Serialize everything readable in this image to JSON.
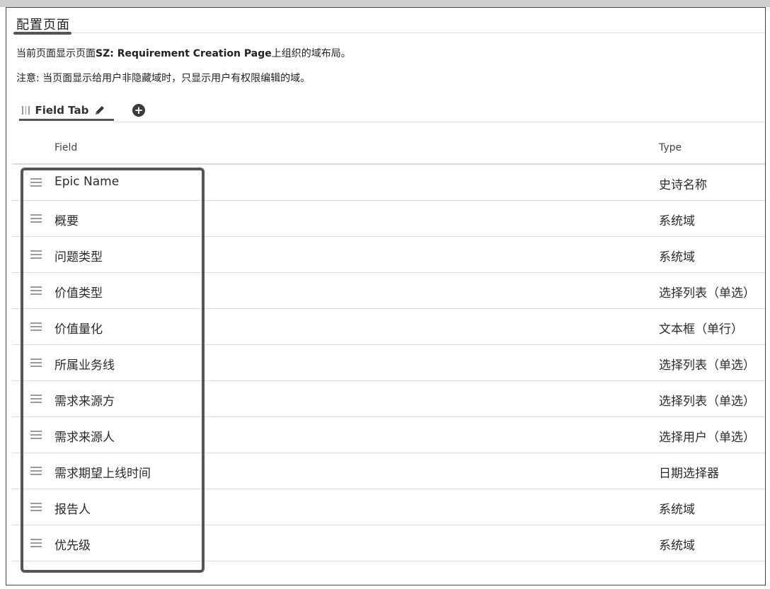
{
  "header": {
    "title": "配置页面"
  },
  "info": {
    "line1_prefix": "当前页面显示页面",
    "line1_page": "SZ: Requirement Creation Page",
    "line1_suffix": "上组织的域布局。",
    "line2": "注意: 当页面显示给用户非隐藏域时，只显示用户有权限编辑的域。"
  },
  "tabs": [
    {
      "label": "Field Tab",
      "icons": [
        "grip-icon",
        "pencil-icon"
      ]
    }
  ],
  "add_tab_icon": "plus-circle-icon",
  "table": {
    "columns": [
      "Field",
      "Type"
    ],
    "rows": [
      {
        "field": "Epic Name",
        "type": "史诗名称"
      },
      {
        "field": "概要",
        "type": "系统域"
      },
      {
        "field": "问题类型",
        "type": "系统域"
      },
      {
        "field": "价值类型",
        "type": "选择列表（单选）"
      },
      {
        "field": "价值量化",
        "type": "文本框（单行）"
      },
      {
        "field": "所属业务线",
        "type": "选择列表（单选）"
      },
      {
        "field": "需求来源方",
        "type": "选择列表（单选）"
      },
      {
        "field": "需求来源人",
        "type": "选择用户（单选）"
      },
      {
        "field": "需求期望上线时间",
        "type": "日期选择器"
      },
      {
        "field": "报告人",
        "type": "系统域"
      },
      {
        "field": "优先级",
        "type": "系统域"
      }
    ]
  },
  "colors": {
    "accent": "#555555",
    "border": "#dcdcdc"
  }
}
